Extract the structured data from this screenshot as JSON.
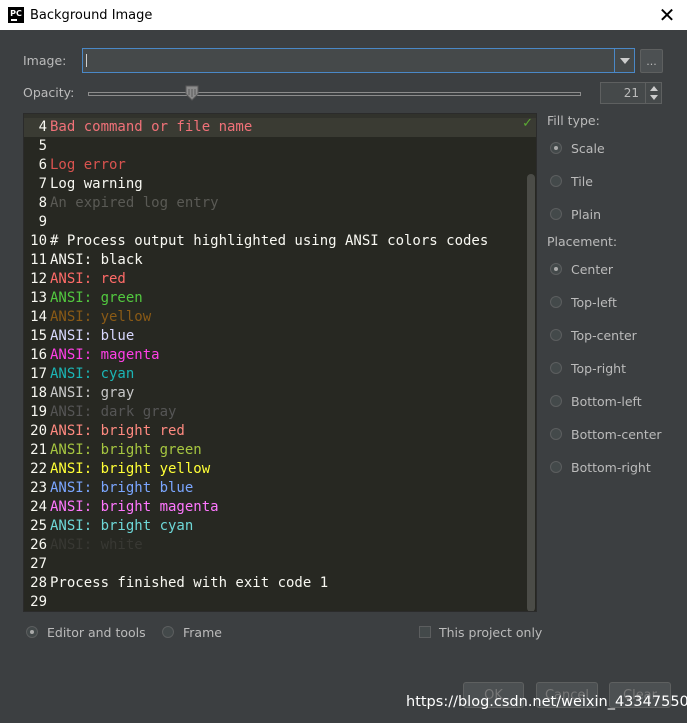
{
  "window": {
    "title": "Background Image",
    "app_icon_text": "PC",
    "close_icon": "close-icon"
  },
  "image_field": {
    "label": "Image:",
    "value": "",
    "browse_label": "..."
  },
  "opacity": {
    "label": "Opacity:",
    "value": "21",
    "level_percent": 21
  },
  "editor": {
    "lines": [
      {
        "num": "4",
        "text": "Bad command or file name",
        "color": "#f07178"
      },
      {
        "num": "5",
        "text": "",
        "color": "#f8f8f2"
      },
      {
        "num": "6",
        "text": "Log error",
        "color": "#d9534f"
      },
      {
        "num": "7",
        "text": "Log warning",
        "color": "#f8f8f2"
      },
      {
        "num": "8",
        "text": "An expired log entry",
        "color": "#5a5a55"
      },
      {
        "num": "9",
        "text": "",
        "color": "#f8f8f2"
      },
      {
        "num": "10",
        "text": "# Process output highlighted using ANSI colors codes",
        "color": "#f8f8f2"
      },
      {
        "num": "11",
        "text": "ANSI: black",
        "color": "#f8f8f2"
      },
      {
        "num": "12",
        "text": "ANSI: red",
        "color": "#ff6b68"
      },
      {
        "num": "13",
        "text": "ANSI: green",
        "color": "#52c93f"
      },
      {
        "num": "14",
        "text": "ANSI: yellow",
        "color": "#8a5a16"
      },
      {
        "num": "15",
        "text": "ANSI: blue",
        "color": "#d8d8ff"
      },
      {
        "num": "16",
        "text": "ANSI: magenta",
        "color": "#ff3fe6"
      },
      {
        "num": "17",
        "text": "ANSI: cyan",
        "color": "#1bb5b5"
      },
      {
        "num": "18",
        "text": "ANSI: gray",
        "color": "#c8c8c8"
      },
      {
        "num": "19",
        "text": "ANSI: dark gray",
        "color": "#555555"
      },
      {
        "num": "20",
        "text": "ANSI: bright red",
        "color": "#ff8a80"
      },
      {
        "num": "21",
        "text": "ANSI: bright green",
        "color": "#a6c640"
      },
      {
        "num": "22",
        "text": "ANSI: bright yellow",
        "color": "#ffff36"
      },
      {
        "num": "23",
        "text": "ANSI: bright blue",
        "color": "#7ba6ff"
      },
      {
        "num": "24",
        "text": "ANSI: bright magenta",
        "color": "#ff77ff"
      },
      {
        "num": "25",
        "text": "ANSI: bright cyan",
        "color": "#6ed8d8"
      },
      {
        "num": "26",
        "text": "ANSI: white",
        "color": "#383833"
      },
      {
        "num": "27",
        "text": "",
        "color": "#f8f8f2"
      },
      {
        "num": "28",
        "text": "Process finished with exit code 1",
        "color": "#f8f8f2"
      },
      {
        "num": "29",
        "text": "",
        "color": "#f8f8f2"
      }
    ]
  },
  "fill_type": {
    "label": "Fill type:",
    "options": [
      {
        "label": "Scale",
        "checked": true
      },
      {
        "label": "Tile",
        "checked": false
      },
      {
        "label": "Plain",
        "checked": false
      }
    ]
  },
  "placement": {
    "label": "Placement:",
    "options": [
      {
        "label": "Center",
        "checked": true
      },
      {
        "label": "Top-left",
        "checked": false
      },
      {
        "label": "Top-center",
        "checked": false
      },
      {
        "label": "Top-right",
        "checked": false
      },
      {
        "label": "Bottom-left",
        "checked": false
      },
      {
        "label": "Bottom-center",
        "checked": false
      },
      {
        "label": "Bottom-right",
        "checked": false
      }
    ]
  },
  "target": {
    "options": [
      {
        "label": "Editor and tools",
        "checked": true
      },
      {
        "label": "Frame",
        "checked": false
      }
    ],
    "project_only_label": "This project only"
  },
  "buttons": {
    "ok": "OK",
    "cancel": "Cancel",
    "clear": "Clear"
  },
  "watermark": "https://blog.csdn.net/weixin_43347550"
}
